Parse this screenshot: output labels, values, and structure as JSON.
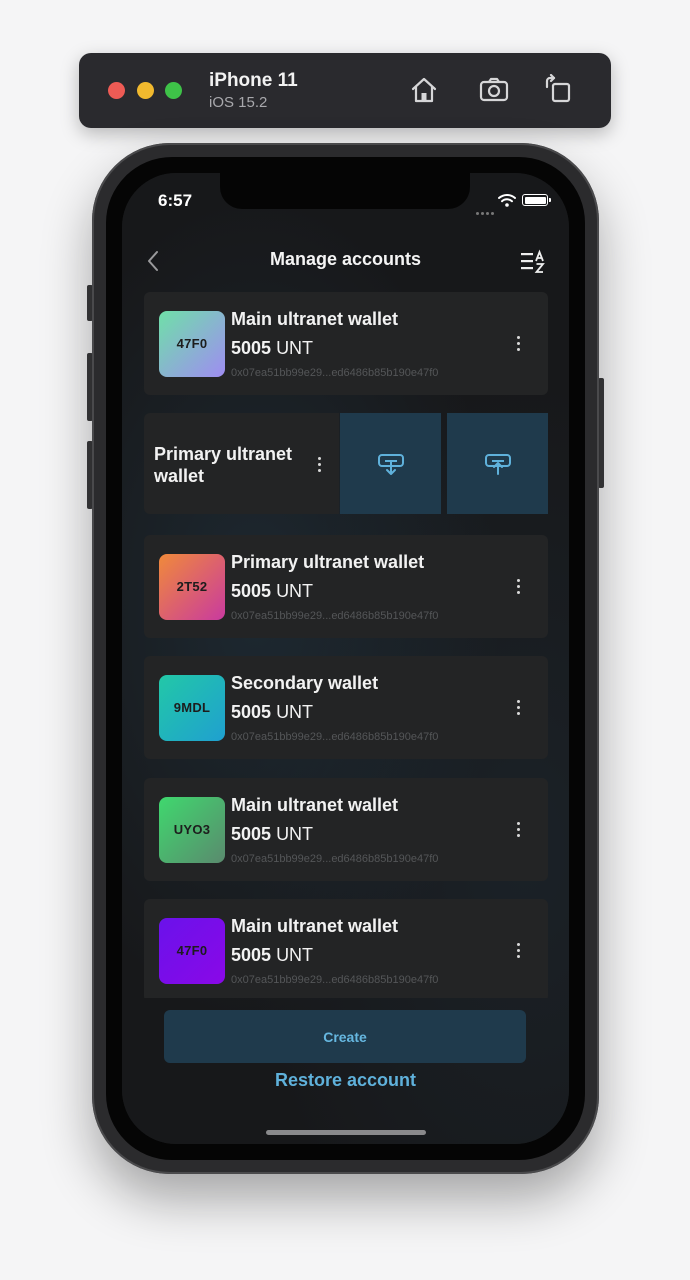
{
  "simulator": {
    "device_name": "iPhone 11",
    "os_version": "iOS 15.2",
    "icons": [
      "home-icon",
      "screenshot-icon",
      "rotate-icon"
    ]
  },
  "status_bar": {
    "time": "6:57"
  },
  "header": {
    "title": "Manage accounts",
    "back_icon": "chevron-left-icon",
    "sort_icon": "sort-az-icon"
  },
  "swiped_account": {
    "name": "Primary ultranet wallet",
    "actions": [
      "receive-icon",
      "send-icon"
    ]
  },
  "accounts": [
    {
      "avatar_label": "47F0",
      "gradient": [
        "#6fe0a8",
        "#9f8cf2"
      ],
      "name": "Main ultranet wallet",
      "balance_amount": "5005",
      "balance_unit": "UNT",
      "address": "0x07ea51bb99e29...ed6486b85b190e47f0"
    },
    {
      "avatar_label": "2T52",
      "gradient": [
        "#f08a3a",
        "#c93a9f"
      ],
      "name": "Primary ultranet wallet",
      "balance_amount": "5005",
      "balance_unit": "UNT",
      "address": "0x07ea51bb99e29...ed6486b85b190e47f0"
    },
    {
      "avatar_label": "9MDL",
      "gradient": [
        "#22c8a7",
        "#1fa0d0"
      ],
      "name": "Secondary wallet",
      "balance_amount": "5005",
      "balance_unit": "UNT",
      "address": "0x07ea51bb99e29...ed6486b85b190e47f0"
    },
    {
      "avatar_label": "UYO3",
      "gradient": [
        "#3fd86e",
        "#5a8a6e"
      ],
      "name": "Main ultranet wallet",
      "balance_amount": "5005",
      "balance_unit": "UNT",
      "address": "0x07ea51bb99e29...ed6486b85b190e47f0"
    },
    {
      "avatar_label": "47F0",
      "gradient": [
        "#6a12ea",
        "#8a08e8"
      ],
      "name": "Main ultranet wallet",
      "balance_amount": "5005",
      "balance_unit": "UNT",
      "address": "0x07ea51bb99e29...ed6486b85b190e47f0"
    }
  ],
  "footer": {
    "create_label": "Create",
    "restore_label": "Restore account"
  },
  "colors": {
    "accent": "#5fb1db",
    "button_bg": "#1f3a4c",
    "card_bg": "#232425",
    "screen_bg": "#17181a"
  }
}
